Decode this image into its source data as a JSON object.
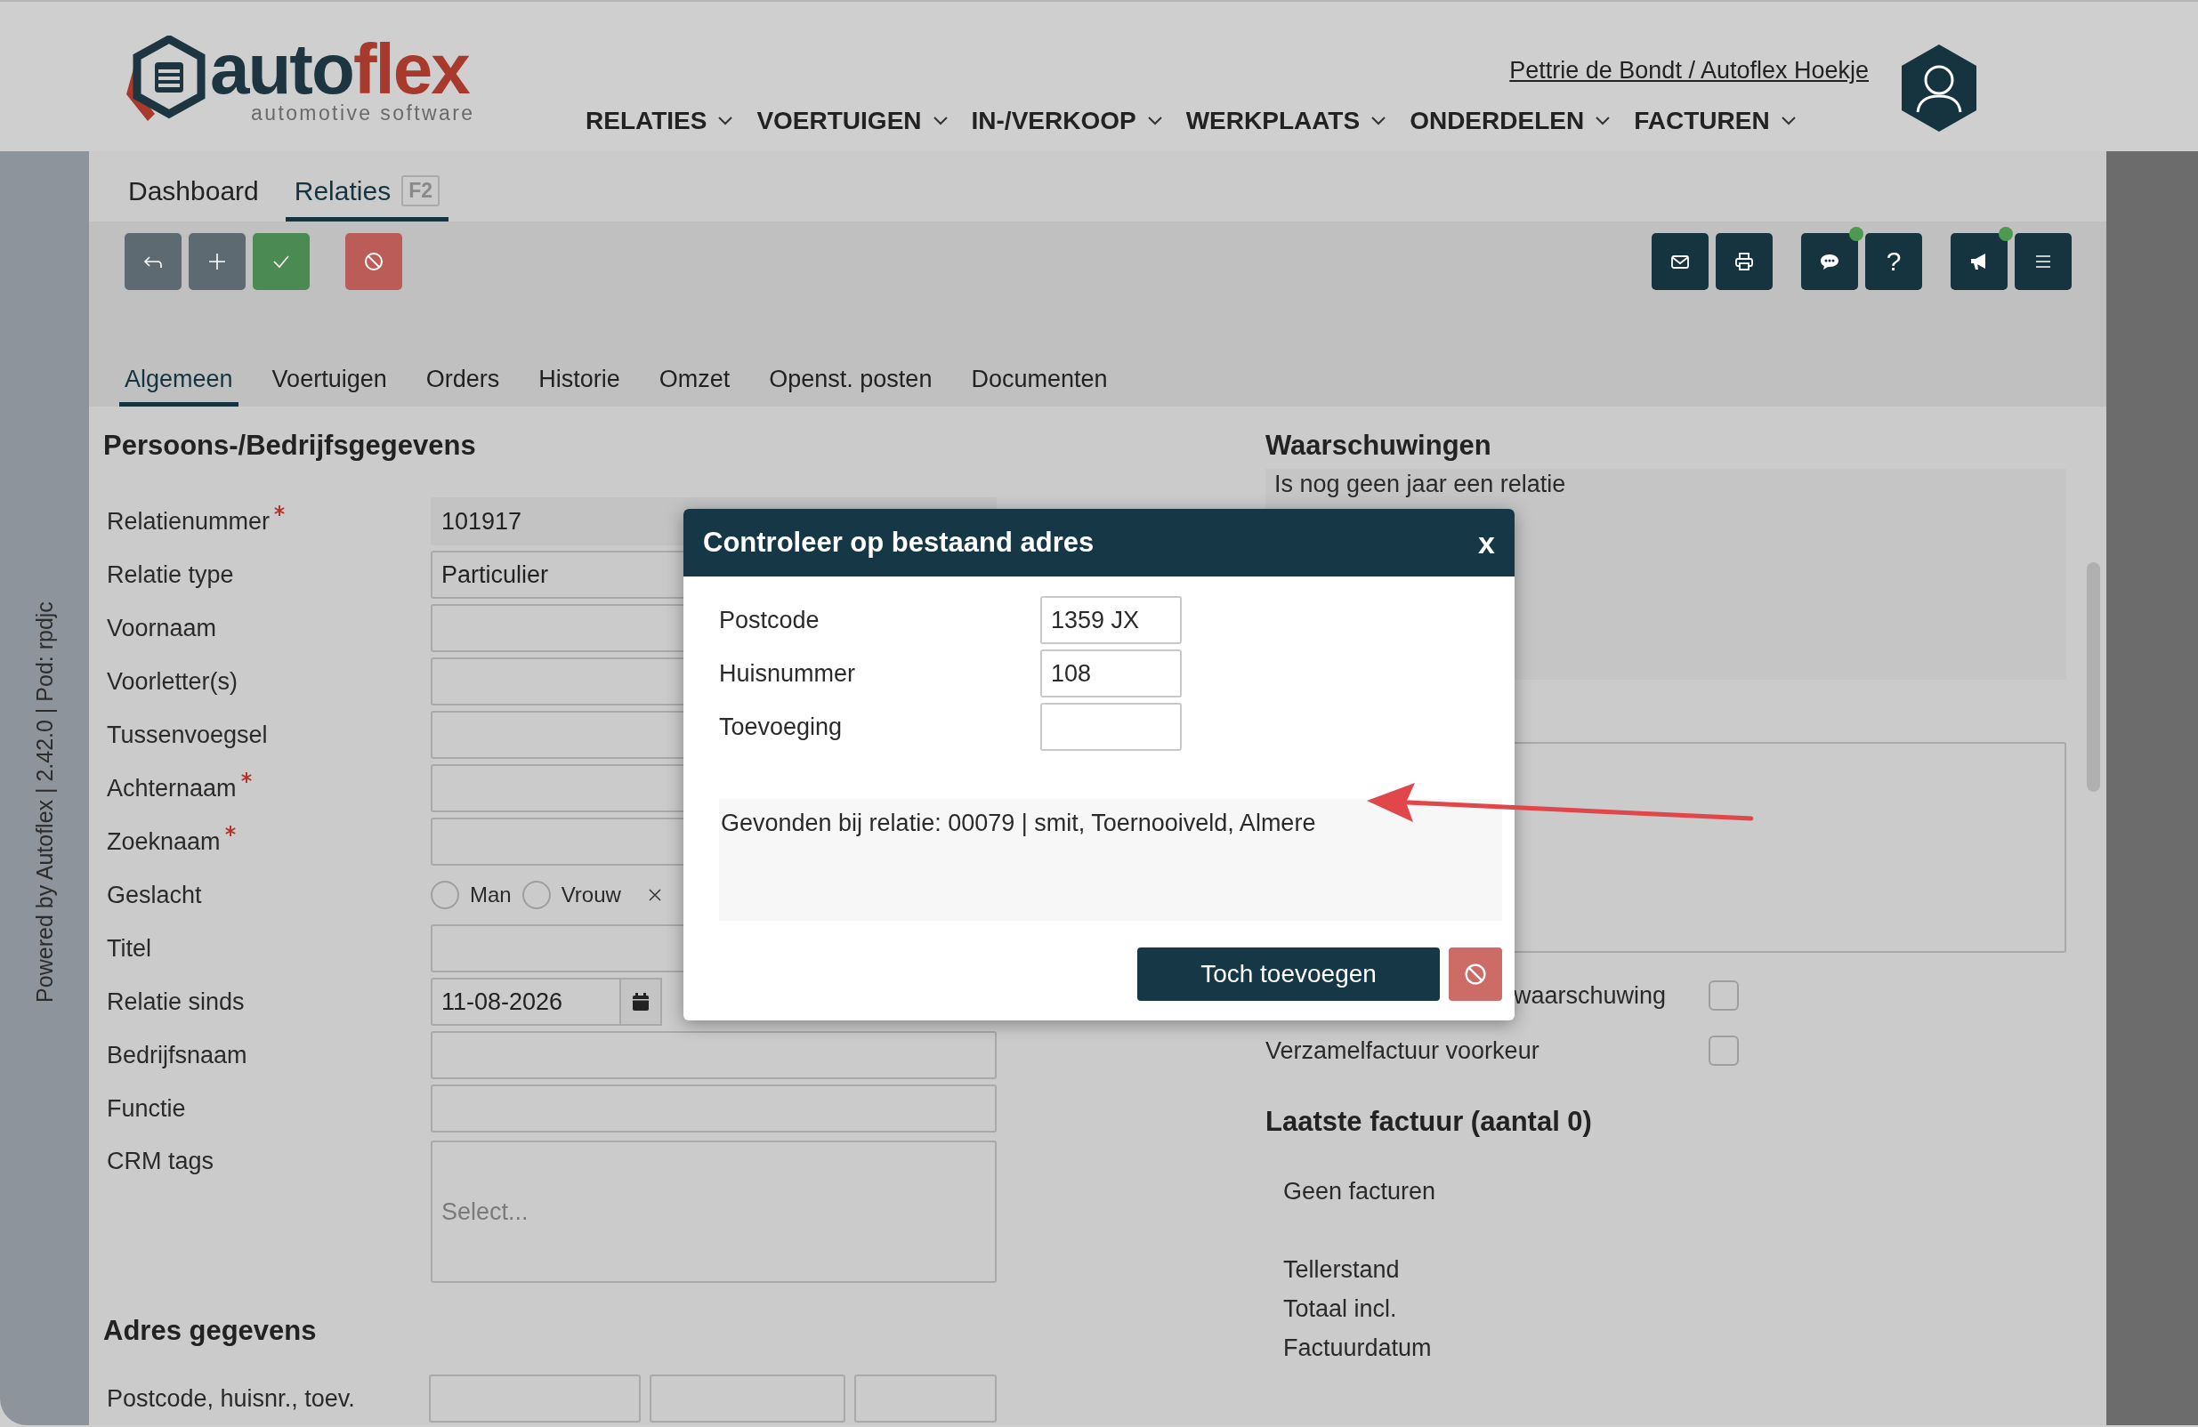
{
  "sidebar_caption": "Powered by Autoflex | 2.42.0 | Pod: rpdjc",
  "header": {
    "wordmark": [
      {
        "text": "auto",
        "color": "#1c3540"
      },
      {
        "text": "flex",
        "color": "#a8392d"
      }
    ],
    "tagline": "automotive software",
    "user": "Pettrie de Bondt / Autoflex Hoekje",
    "nav": [
      "RELATIES",
      "VOERTUIGEN",
      "IN-/VERKOOP",
      "WERKPLAATS",
      "ONDERDELEN",
      "FACTUREN"
    ]
  },
  "page_tabs": [
    {
      "label": "Dashboard",
      "selected": false
    },
    {
      "label": "Relaties",
      "shortcut": "F2",
      "selected": true
    }
  ],
  "toolbar": {
    "left": [
      {
        "kind": "back"
      },
      {
        "kind": "add"
      },
      {
        "kind": "save"
      },
      {
        "kind": "cancel"
      }
    ],
    "right": [
      {
        "kind": "mail",
        "notification": false
      },
      {
        "kind": "print",
        "notification": false
      },
      {
        "kind": "chat",
        "notification": true
      },
      {
        "kind": "help",
        "label": "?",
        "notification": false
      },
      {
        "kind": "announce",
        "notification": true
      },
      {
        "kind": "menu",
        "notification": false
      }
    ]
  },
  "section_tabs": [
    {
      "label": "Algemeen",
      "selected": true
    },
    {
      "label": "Voertuigen",
      "selected": false
    },
    {
      "label": "Orders",
      "selected": false
    },
    {
      "label": "Historie",
      "selected": false
    },
    {
      "label": "Omzet",
      "selected": false
    },
    {
      "label": "Openst. posten",
      "selected": false
    },
    {
      "label": "Documenten",
      "selected": false
    }
  ],
  "person_section": {
    "title": "Persoons-/Bedrijfsgegevens",
    "fields": [
      {
        "label": "Relatienummer",
        "required": true,
        "kind": "readonly",
        "value": "101917"
      },
      {
        "label": "Relatie type",
        "required": false,
        "kind": "select",
        "value": "Particulier"
      },
      {
        "label": "Voornaam",
        "required": false,
        "kind": "text"
      },
      {
        "label": "Voorletter(s)",
        "required": false,
        "kind": "text"
      },
      {
        "label": "Tussenvoegsel",
        "required": false,
        "kind": "text"
      },
      {
        "label": "Achternaam",
        "required": true,
        "kind": "text"
      },
      {
        "label": "Zoeknaam",
        "required": true,
        "kind": "text"
      },
      {
        "label": "Geslacht",
        "required": false,
        "kind": "radio",
        "options": [
          {
            "label": "Man",
            "selected": false
          },
          {
            "label": "Vrouw",
            "selected": false
          }
        ]
      },
      {
        "label": "Titel",
        "required": false,
        "kind": "text"
      },
      {
        "label": "Relatie sinds",
        "required": false,
        "kind": "date",
        "value": "11-08-2026"
      },
      {
        "label": "Bedrijfsnaam",
        "required": false,
        "kind": "text"
      },
      {
        "label": "Functie",
        "required": false,
        "kind": "text"
      },
      {
        "label": "CRM tags",
        "required": false,
        "kind": "tags",
        "placeholder": "Select..."
      }
    ]
  },
  "address_section": {
    "title": "Adres gegevens",
    "fields": [
      {
        "label": "Postcode, huisnr., toev.",
        "required": false,
        "kind": "triple"
      }
    ]
  },
  "warnings": {
    "title": "Waarschuwingen",
    "items": [
      "Is nog geen jaar een relatie"
    ]
  },
  "options": [
    {
      "label": "waarschuwing",
      "checked": false
    },
    {
      "label": "Verzamelfactuur voorkeur",
      "checked": false
    }
  ],
  "last_invoice": {
    "title": "Laatste factuur (aantal 0)",
    "empty_text": "Geen facturen",
    "fields": [
      "Tellerstand",
      "Totaal incl.",
      "Factuurdatum"
    ]
  },
  "dialog": {
    "title": "Controleer op bestaand adres",
    "close": "x",
    "fields": [
      {
        "label": "Postcode",
        "value": "1359 JX"
      },
      {
        "label": "Huisnummer",
        "value": "108"
      },
      {
        "label": "Toevoeging"
      }
    ],
    "result": "Gevonden bij relatie: 00079 | smit, Toernooiveld, Almere",
    "confirm": "Toch toevoegen"
  }
}
